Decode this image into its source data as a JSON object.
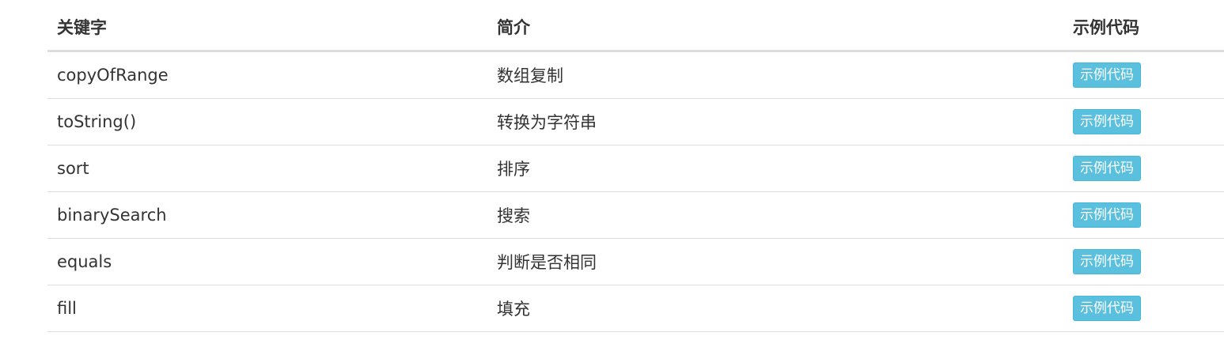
{
  "table": {
    "headers": [
      "关键字",
      "简介",
      "示例代码"
    ],
    "rows": [
      {
        "keyword": "copyOfRange",
        "desc": "数组复制",
        "action": "示例代码"
      },
      {
        "keyword": "toString()",
        "desc": "转换为字符串",
        "action": "示例代码"
      },
      {
        "keyword": "sort",
        "desc": "排序",
        "action": "示例代码"
      },
      {
        "keyword": "binarySearch",
        "desc": "搜索",
        "action": "示例代码"
      },
      {
        "keyword": "equals",
        "desc": "判断是否相同",
        "action": "示例代码"
      },
      {
        "keyword": "fill",
        "desc": "填充",
        "action": "示例代码"
      }
    ]
  },
  "colors": {
    "button_bg": "#5bc0de",
    "button_border": "#46b8da",
    "border": "#dddddd",
    "text": "#333333"
  }
}
